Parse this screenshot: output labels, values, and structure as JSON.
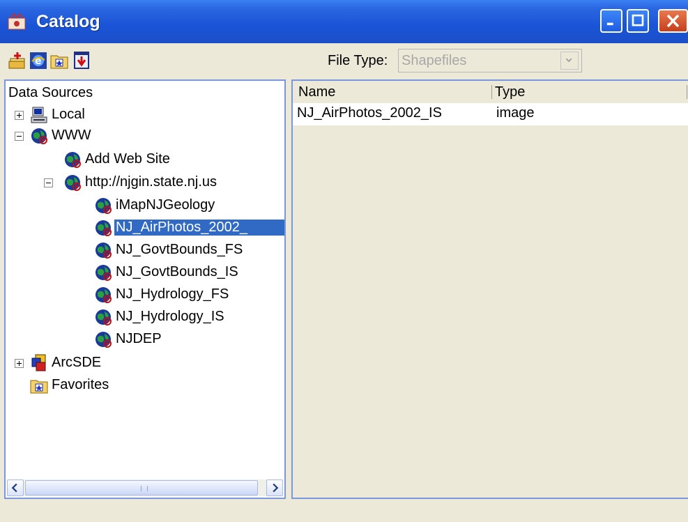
{
  "window": {
    "title": "Catalog"
  },
  "toolbar": {
    "buttons": [
      "add-data-icon",
      "internet-explorer-icon",
      "favorites-folder-icon",
      "download-icon"
    ],
    "file_type_label": "File Type:",
    "file_type_value": "Shapefiles"
  },
  "tree": {
    "root": "Data Sources",
    "nodes": [
      {
        "label": "Local",
        "icon": "computer-icon",
        "expander": "plus"
      },
      {
        "label": "WWW",
        "icon": "globe-icon",
        "expander": "minus"
      },
      {
        "label": "Add Web Site",
        "icon": "globe-icon"
      },
      {
        "label": "http://njgin.state.nj.us",
        "icon": "globe-icon",
        "expander": "minus"
      },
      {
        "label": "iMapNJGeology",
        "icon": "globe-icon"
      },
      {
        "label": "NJ_AirPhotos_2002_",
        "icon": "globe-icon",
        "selected": true
      },
      {
        "label": "NJ_GovtBounds_FS",
        "icon": "globe-icon"
      },
      {
        "label": "NJ_GovtBounds_IS",
        "icon": "globe-icon"
      },
      {
        "label": "NJ_Hydrology_FS",
        "icon": "globe-icon"
      },
      {
        "label": "NJ_Hydrology_IS",
        "icon": "globe-icon"
      },
      {
        "label": "NJDEP",
        "icon": "globe-icon"
      },
      {
        "label": "ArcSDE",
        "icon": "database-icon",
        "expander": "plus"
      },
      {
        "label": "Favorites",
        "icon": "favorites-folder-icon"
      }
    ]
  },
  "table": {
    "columns": [
      "Name",
      "Type"
    ],
    "rows": [
      {
        "name": "NJ_AirPhotos_2002_IS",
        "type": "image"
      }
    ]
  },
  "colors": {
    "title_bar": "#2a66e0",
    "selection": "#316ac5",
    "panel_border": "#7a96df"
  }
}
